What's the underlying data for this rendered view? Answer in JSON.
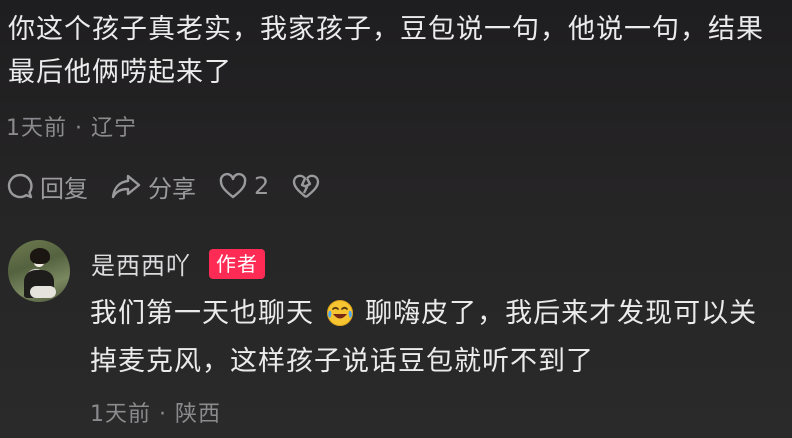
{
  "comment": {
    "text": "你这个孩子真老实，我家孩子，豆包说一句，他说一句，结果最后他俩唠起来了",
    "meta": "1天前 · 辽宁"
  },
  "actions": {
    "reply_label": "回复",
    "share_label": "分享",
    "like_count": "2"
  },
  "reply": {
    "username": "是西西吖",
    "badge": "作者",
    "text_before_emoji": "我们第一天也聊天",
    "emoji": "laughing-crying-emoji",
    "text_after_emoji": "聊嗨皮了，我后来才发现可以关掉麦克风，这样孩子说话豆包就听不到了",
    "meta": "1天前 · 陕西"
  },
  "colors": {
    "background": "#232223",
    "text": "#ecebec",
    "muted": "#8b8a8d",
    "author_badge": "#fe2c55"
  }
}
